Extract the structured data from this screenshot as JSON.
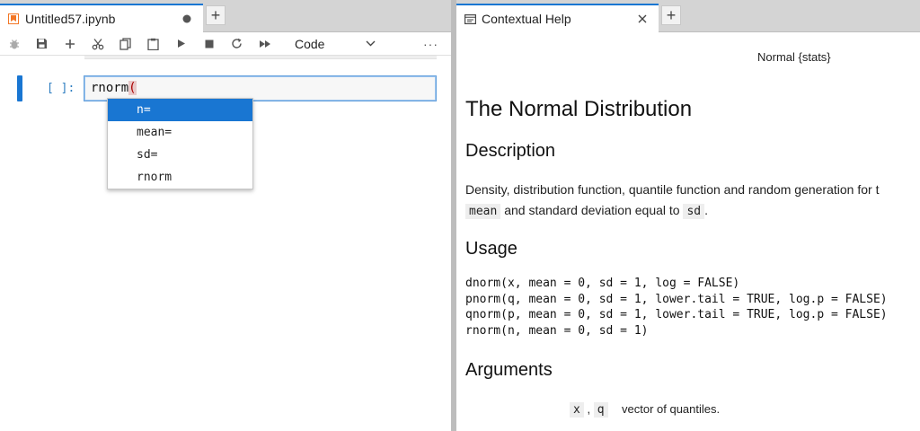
{
  "notebook_tab": {
    "title": "Untitled57.ipynb",
    "status_icon": "dirty-dot-icon",
    "icon": "notebook-icon"
  },
  "help_tab": {
    "title": "Contextual Help",
    "icon": "help-panel-icon"
  },
  "toolbar": {
    "buttons": [
      "bug-icon",
      "save-icon",
      "add-icon",
      "cut-icon",
      "copy-icon",
      "paste-icon",
      "run-icon",
      "stop-icon",
      "restart-icon",
      "fast-forward-icon"
    ],
    "cell_type": "Code",
    "more": "···"
  },
  "cell": {
    "prompt": "[ ]:",
    "code_text": "rnorm",
    "open_paren": "("
  },
  "completer": {
    "items": [
      "n=",
      "mean=",
      "sd=",
      "rnorm"
    ],
    "active_index": 0
  },
  "help": {
    "header": "Normal {stats}",
    "title": "The Normal Distribution",
    "description_heading": "Description",
    "description_text_1": "Density, distribution function, quantile function and random generation for t",
    "description_code_mean": "mean",
    "description_text_2": "and standard deviation equal to",
    "description_code_sd": "sd",
    "description_text_3": ".",
    "usage_heading": "Usage",
    "usage_lines": [
      "dnorm(x, mean = 0, sd = 1, log = FALSE)",
      "pnorm(q, mean = 0, sd = 1, lower.tail = TRUE, log.p = FALSE)",
      "qnorm(p, mean = 0, sd = 1, lower.tail = TRUE, log.p = FALSE)",
      "rnorm(n, mean = 0, sd = 1)"
    ],
    "arguments_heading": "Arguments",
    "arg_name_1": "x",
    "arg_sep": ",",
    "arg_name_2": "q",
    "arg_desc": "vector of quantiles."
  },
  "colors": {
    "accent": "#1976d2",
    "prompt": "#307fc1",
    "notebook_icon": "#f37726"
  }
}
